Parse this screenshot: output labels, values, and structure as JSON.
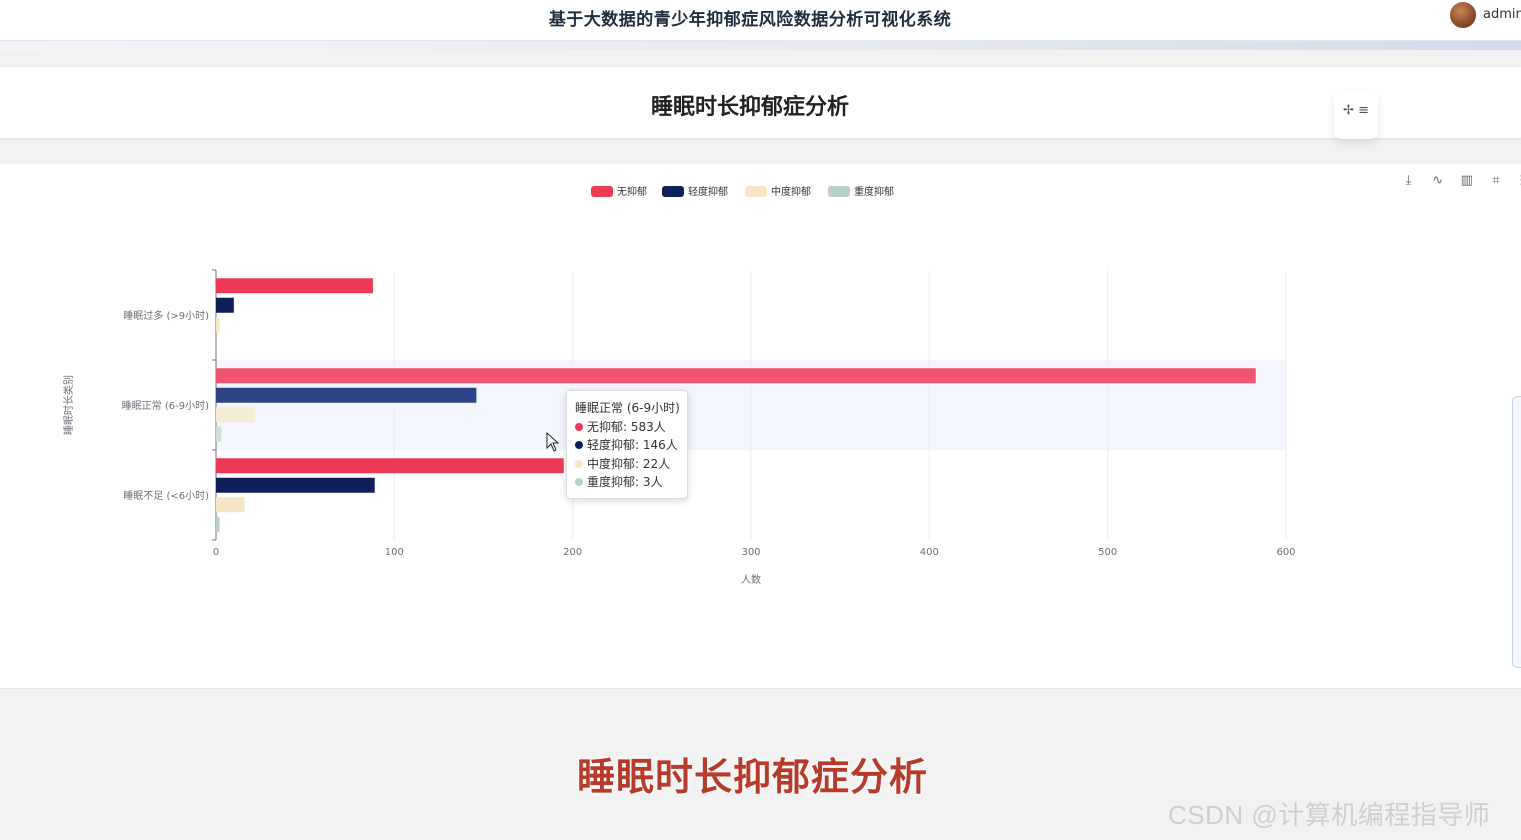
{
  "header": {
    "system_title": "基于大数据的青少年抑郁症风险数据分析可视化系统",
    "username": "admin",
    "avatar_icon": "user-avatar"
  },
  "page": {
    "title": "睡眠时长抑郁症分析",
    "move_icon": "move-icon",
    "menu_icon": "menu-icon"
  },
  "toolbox": {
    "icons": [
      "download-icon",
      "line-chart-icon",
      "bar-chart-icon",
      "crop-icon",
      "more-icon"
    ]
  },
  "chart_data": {
    "type": "bar",
    "orientation": "horizontal",
    "categories": [
      "睡眠不足 (<6小时)",
      "睡眠正常 (6-9小时)",
      "睡眠过多 (>9小时)"
    ],
    "series": [
      {
        "name": "无抑郁",
        "color": "#ee3a57",
        "values": [
          195,
          583,
          88
        ]
      },
      {
        "name": "轻度抑郁",
        "color": "#0f1f5c",
        "values": [
          89,
          146,
          10
        ]
      },
      {
        "name": "中度抑郁",
        "color": "#f5e7c5",
        "values": [
          16,
          22,
          2
        ]
      },
      {
        "name": "重度抑郁",
        "color": "#b9d2c9",
        "values": [
          2,
          3,
          0
        ]
      }
    ],
    "xlabel": "人数",
    "ylabel": "睡眠时长类别",
    "xlim": [
      0,
      600
    ],
    "xticks": [
      0,
      100,
      200,
      300,
      400,
      500,
      600
    ],
    "grid": true,
    "legend": "top-center",
    "highlighted_category": "睡眠正常 (6-9小时)"
  },
  "tooltip": {
    "title": "睡眠正常 (6-9小时)",
    "rows": [
      {
        "label": "无抑郁: 583人",
        "color": "#ee3a57"
      },
      {
        "label": "轻度抑郁: 146人",
        "color": "#0f1f5c"
      },
      {
        "label": "中度抑郁: 22人",
        "color": "#f5e7c5"
      },
      {
        "label": "重度抑郁: 3人",
        "color": "#b9d2c9"
      }
    ]
  },
  "caption": "睡眠时长抑郁症分析",
  "watermark": "CSDN @计算机编程指导师"
}
